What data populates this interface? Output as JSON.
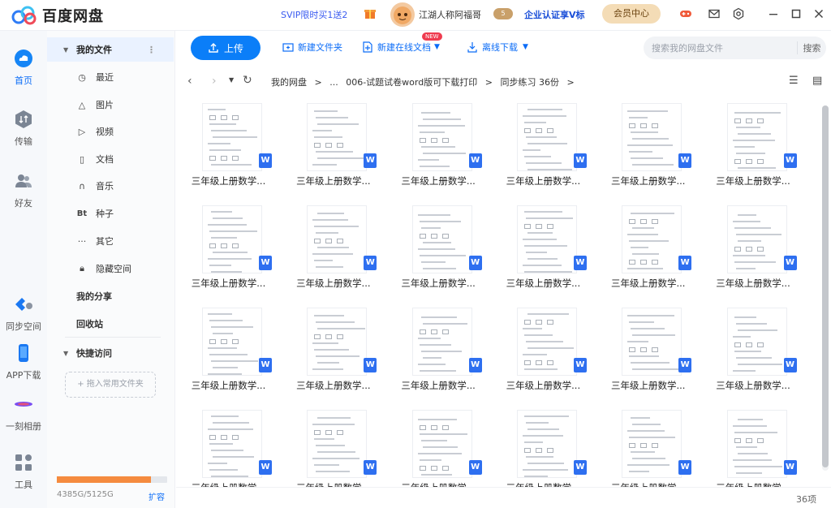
{
  "app": {
    "title": "百度网盘",
    "svip_promo": "SVIP限时买1送2",
    "username": "江湖人称阿福哥",
    "vip_level": "5",
    "enterprise": "企业认证享V标",
    "member_center": "会员中心"
  },
  "rail": {
    "items": [
      {
        "label": "首页",
        "icon": "cloud-icon"
      },
      {
        "label": "传输",
        "icon": "transfer-icon"
      },
      {
        "label": "好友",
        "icon": "friends-icon"
      },
      {
        "label": "同步空间",
        "icon": "sync-icon"
      },
      {
        "label": "APP下载",
        "icon": "phone-icon"
      },
      {
        "label": "一刻相册",
        "icon": "album-icon"
      },
      {
        "label": "工具",
        "icon": "tools-icon"
      }
    ]
  },
  "sidebar": {
    "my_files": "我的文件",
    "items": [
      {
        "label": "最近",
        "icon": "clock-icon"
      },
      {
        "label": "图片",
        "icon": "image-icon"
      },
      {
        "label": "视频",
        "icon": "play-icon"
      },
      {
        "label": "文档",
        "icon": "document-icon"
      },
      {
        "label": "音乐",
        "icon": "headphones-icon"
      },
      {
        "label": "种子",
        "icon": "bt-icon"
      },
      {
        "label": "其它",
        "icon": "more-icon"
      },
      {
        "label": "隐藏空间",
        "icon": "lock-icon"
      }
    ],
    "my_share": "我的分享",
    "recycle": "回收站",
    "quick_access": "快捷访问",
    "drop_hint": "+ 拖入常用文件夹",
    "storage_text": "4385G/5125G",
    "storage_fraction": 0.856,
    "expand": "扩容"
  },
  "toolbar": {
    "upload": "上传",
    "new_folder": "新建文件夹",
    "new_online_doc": "新建在线文档",
    "new_badge": "NEW",
    "offline_download": "离线下载",
    "search_placeholder": "搜索我的网盘文件",
    "search_button": "搜索"
  },
  "breadcrumb": {
    "items": [
      "我的网盘",
      ">",
      "...",
      "006-试题试卷word版可下载打印",
      ">",
      "同步练习 36份",
      ">"
    ]
  },
  "files": {
    "name": "三年级上册数学...",
    "badge": "W",
    "count": 24
  },
  "status": {
    "count": "36项"
  }
}
